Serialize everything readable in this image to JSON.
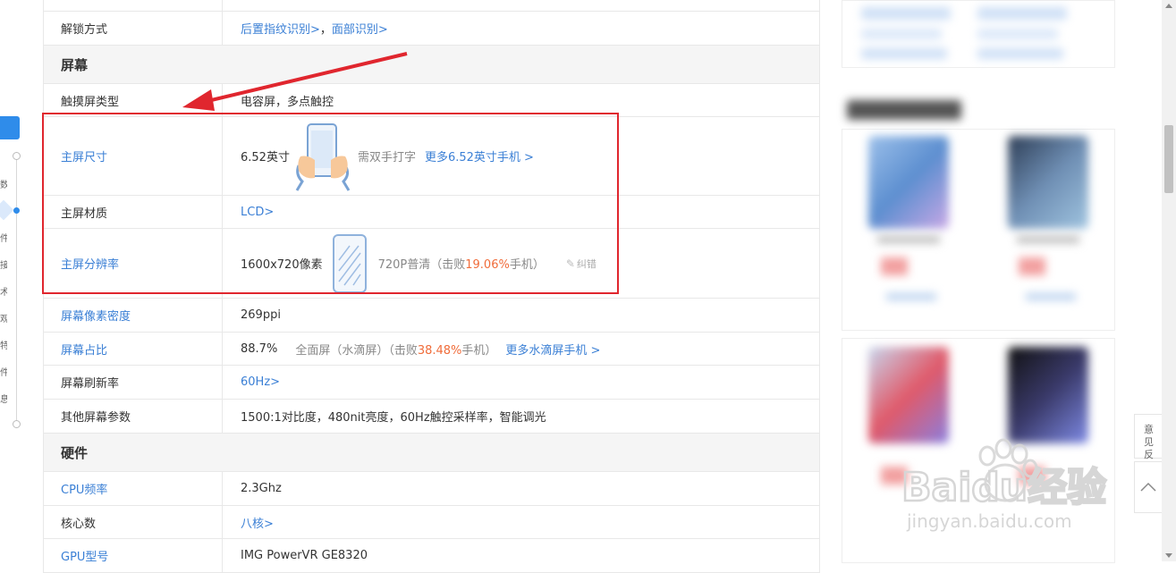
{
  "left_nav": {
    "active_label": "",
    "labels": [
      "数",
      "",
      "件",
      "接",
      "术",
      "观",
      "特",
      "件",
      "息"
    ]
  },
  "spec_rows": {
    "top_partial": {
      "key": "",
      "value": ""
    },
    "unlock": {
      "key": "解锁方式",
      "links": [
        "后置指纹识别>",
        "面部识别>"
      ],
      "sep": "，"
    },
    "section_screen": "屏幕",
    "touch_type": {
      "key": "触摸屏类型",
      "value": "电容屏，多点触控"
    },
    "main_size": {
      "key": "主屏尺寸",
      "value": "6.52英寸",
      "note": "需双手打字",
      "link": "更多6.52英寸手机 >"
    },
    "main_material": {
      "key": "主屏材质",
      "link": "LCD>"
    },
    "main_res": {
      "key": "主屏分辨率",
      "value": "1600x720像素",
      "note_pre": "720P普清（击败",
      "percent": "19.06%",
      "note_post": "手机）",
      "report": "纠错"
    },
    "ppi": {
      "key": "屏幕像素密度",
      "value": "269ppi"
    },
    "ratio": {
      "key": "屏幕占比",
      "value": "88.7%",
      "note_pre": "全面屏（水滴屏）（击败",
      "percent": "38.48%",
      "note_post": "手机）",
      "link": "更多水滴屏手机 >"
    },
    "refresh": {
      "key": "屏幕刷新率",
      "link": "60Hz>"
    },
    "other": {
      "key": "其他屏幕参数",
      "value": "1500:1对比度，480nit亮度，60Hz触控采样率，智能调光"
    },
    "section_hw": "硬件",
    "cpu": {
      "key": "CPU频率",
      "value": "2.3Ghz"
    },
    "cores": {
      "key": "核心数",
      "link": "八核>"
    },
    "gpu": {
      "key": "GPU型号",
      "value": "IMG PowerVR GE8320"
    }
  },
  "sidebar": {
    "feedback_label": "意见反馈"
  },
  "watermark": {
    "brand": "Baidu经验",
    "url": "jingyan.baidu.com"
  },
  "colors": {
    "accent": "#3a7fd5",
    "highlight": "#e0262e",
    "orange": "#f06c3a"
  }
}
